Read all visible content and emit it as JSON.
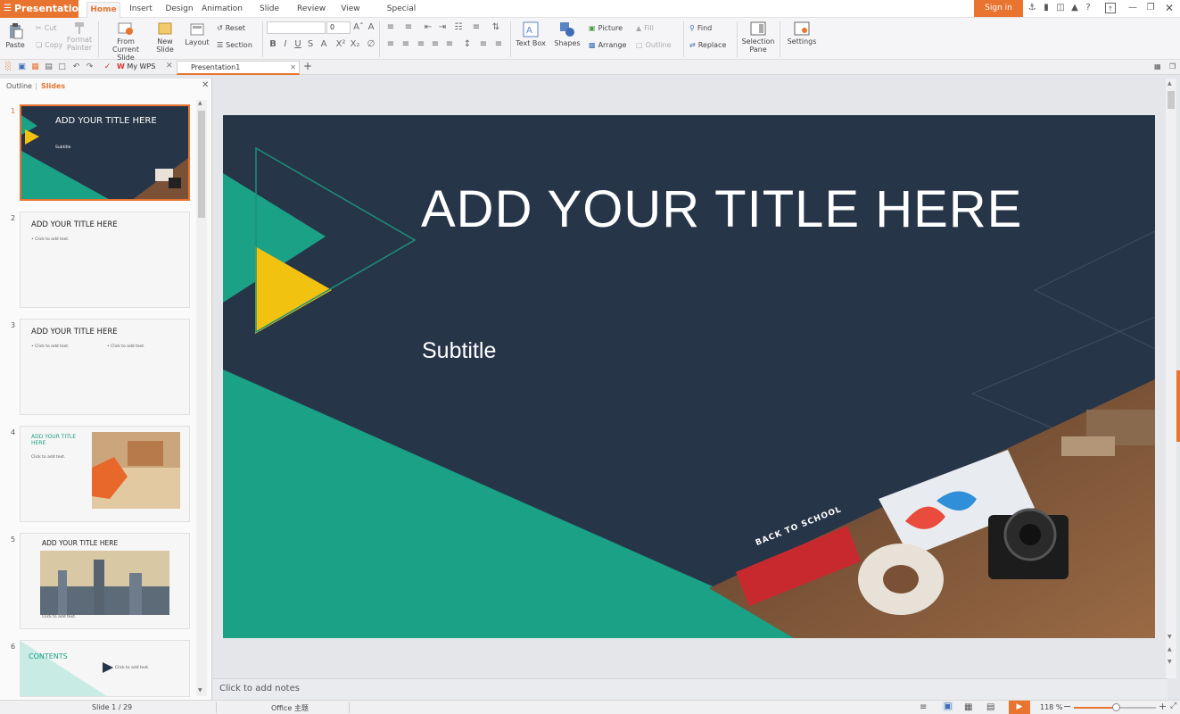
{
  "app": {
    "name": "Presentation",
    "sign_in": "Sign in"
  },
  "menu_tabs": [
    "Home",
    "Insert",
    "Design",
    "Animation",
    "Slide Show",
    "Review",
    "View",
    "Special Features"
  ],
  "ribbon": {
    "paste": "Paste",
    "cut": "Cut",
    "copy": "Copy",
    "format_painter": "Format Painter",
    "from_current_slide": "From Current Slide",
    "new_slide": "New Slide",
    "layout": "Layout",
    "reset": "Reset",
    "section": "Section",
    "font_size": "0",
    "text_box": "Text Box",
    "shapes": "Shapes",
    "picture": "Picture",
    "arrange": "Arrange",
    "fill": "Fill",
    "outline": "Outline",
    "find": "Find",
    "replace": "Replace",
    "selection_pane": "Selection Pane",
    "settings": "Settings"
  },
  "docbar": {
    "my_wps": "My WPS",
    "doc_tab": "Presentation1"
  },
  "left_pane": {
    "tab_outline": "Outline",
    "tab_slides": "Slides"
  },
  "thumbnails": [
    {
      "num": "1",
      "title": "ADD YOUR TITLE HERE",
      "sub": "Subtitle"
    },
    {
      "num": "2",
      "title": "ADD YOUR TITLE HERE",
      "text1": "• Click to add text."
    },
    {
      "num": "3",
      "title": "ADD YOUR TITLE HERE",
      "text1": "• Click to add text.",
      "text2": "• Click to add text."
    },
    {
      "num": "4",
      "title": "ADD YOUR TITLE HERE",
      "text1": "Click to add text."
    },
    {
      "num": "5",
      "title": "ADD YOUR TITLE HERE",
      "text1": "Click to add text."
    },
    {
      "num": "6",
      "title": "CONTENTS",
      "text1": "Click to add text."
    }
  ],
  "slide": {
    "title": "ADD YOUR TITLE HERE",
    "subtitle": "Subtitle",
    "photo_text": "BACK TO SCHOOL"
  },
  "notes_placeholder": "Click to add notes",
  "status": {
    "slide_info": "Slide 1 / 29",
    "theme": "Office 主题",
    "zoom": "118 %"
  },
  "colors": {
    "accent": "#e8742f",
    "slide_bg": "#273549",
    "teal": "#1aa186",
    "yellow": "#f2c211"
  }
}
